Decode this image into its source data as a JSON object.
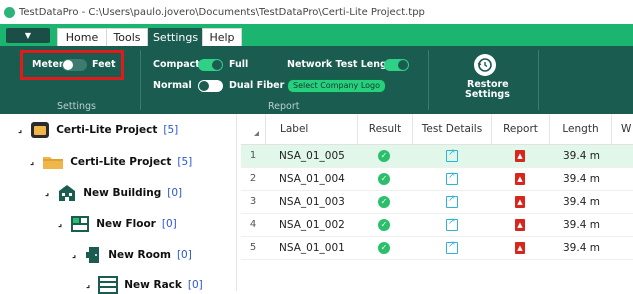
{
  "window": {
    "title": "TestDataPro - C:\\Users\\paulo.jovero\\Documents\\TestDataPro\\Certi-Lite Project.tpp"
  },
  "tabs": [
    {
      "label": "Home"
    },
    {
      "label": "Tools"
    },
    {
      "label": "Settings"
    },
    {
      "label": "Help"
    }
  ],
  "ribbon": {
    "meter_label": "Meter",
    "feet_label": "Feet",
    "compact_label": "Compact",
    "full_label": "Full",
    "normal_label": "Normal",
    "dual_fiber_label": "Dual Fiber",
    "network_test_length_label": "Network Test Length",
    "select_logo_label": "Select Company Logo",
    "restore_label_1": "Restore",
    "restore_label_2": "Settings",
    "group_settings": "Settings",
    "group_report": "Report"
  },
  "tree": [
    {
      "name": "Certi-Lite Project",
      "count": "[5]",
      "icon": "project-icon"
    },
    {
      "name": "Certi-Lite Project",
      "count": "[5]",
      "icon": "folder-icon"
    },
    {
      "name": "New Building",
      "count": "[0]",
      "icon": "building-icon"
    },
    {
      "name": "New Floor",
      "count": "[0]",
      "icon": "floor-icon"
    },
    {
      "name": "New Room",
      "count": "[0]",
      "icon": "room-icon"
    },
    {
      "name": "New Rack",
      "count": "[0]",
      "icon": "rack-icon"
    }
  ],
  "grid": {
    "headers": [
      "Label",
      "Result",
      "Test Details",
      "Report",
      "Length",
      "W"
    ],
    "rows": [
      {
        "num": "1",
        "label": "NSA_01_005",
        "length": "39.4 m"
      },
      {
        "num": "2",
        "label": "NSA_01_004",
        "length": "39.4 m"
      },
      {
        "num": "3",
        "label": "NSA_01_003",
        "length": "39.4 m"
      },
      {
        "num": "4",
        "label": "NSA_01_002",
        "length": "39.4 m"
      },
      {
        "num": "5",
        "label": "NSA_01_001",
        "length": "39.4 m"
      }
    ]
  },
  "colors": {
    "accent": "#1bb570",
    "ribbon": "#1b5c51",
    "highlight": "#e01b1b",
    "selected_row": "#e0f7ea"
  }
}
